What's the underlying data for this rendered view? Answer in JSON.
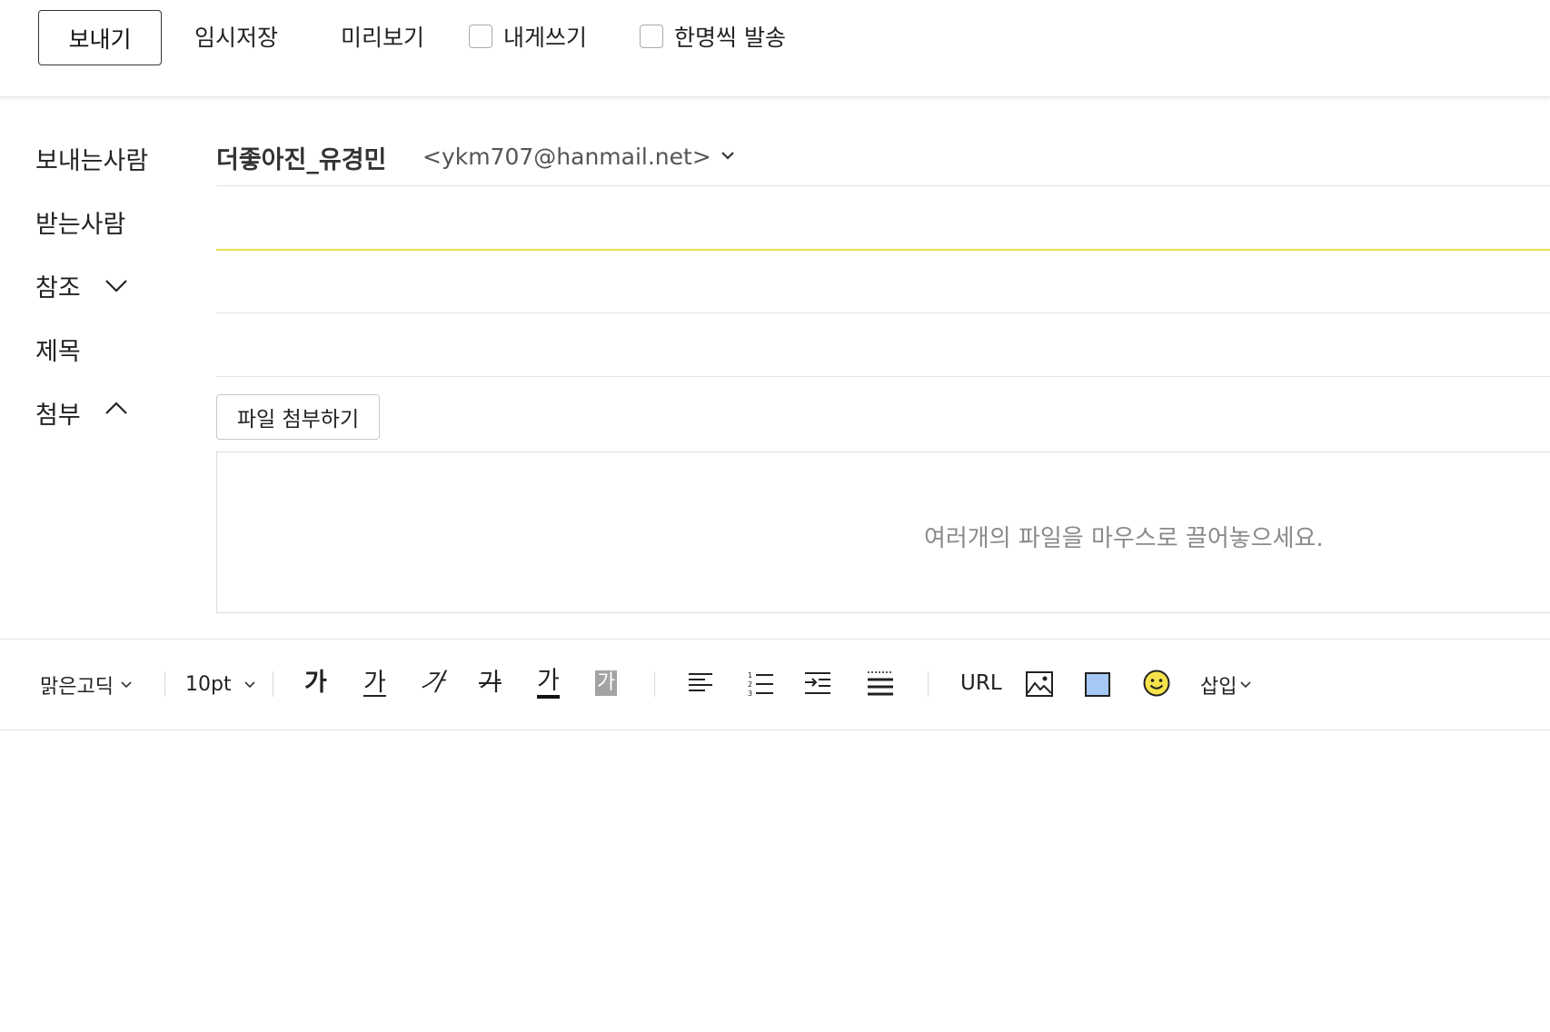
{
  "toolbar": {
    "send_label": "보내기",
    "save_draft_label": "임시저장",
    "preview_label": "미리보기",
    "self_mail_label": "내게쓰기",
    "individual_send_label": "한명씩 발송"
  },
  "fields": {
    "from_label": "보내는사람",
    "sender_name": "더좋아진_유경민",
    "sender_email": "<ykm707@hanmail.net>",
    "to_label": "받는사람",
    "cc_label": "참조",
    "subject_label": "제목",
    "attach_label": "첨부"
  },
  "attachment": {
    "button_label": "파일 첨부하기",
    "drop_hint": "여러개의 파일을 마우스로 끌어놓으세요."
  },
  "editor": {
    "font_family": "맑은고딕",
    "font_size": "10pt",
    "bold": "가",
    "underline": "가",
    "italic": "가",
    "strike": "가",
    "font_color": "가",
    "bg_color": "가",
    "url_label": "URL",
    "insert_label": "삽입",
    "icons": [
      "align-left-icon",
      "numbered-list-icon",
      "indent-icon",
      "line-spacing-icon",
      "image-icon",
      "table-icon",
      "emoji-icon"
    ]
  },
  "colors": {
    "active_field_line": "#e8e04a",
    "table_icon_fill": "#a6c8f5",
    "emoji_fill": "#f7e34b"
  }
}
